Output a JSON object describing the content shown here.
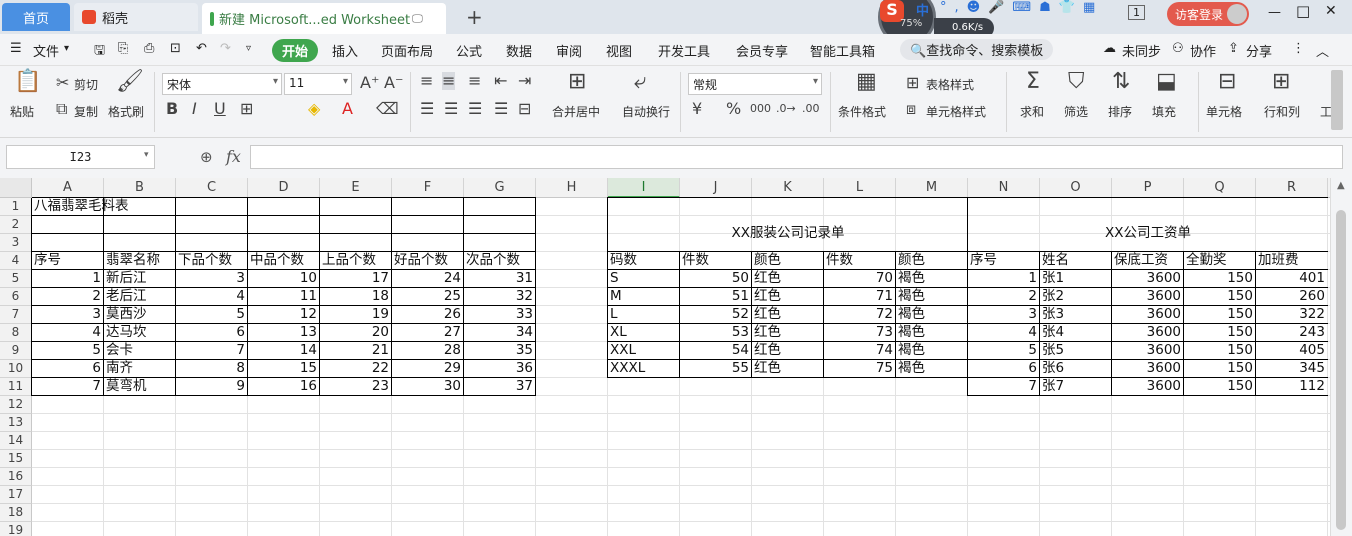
{
  "tabs": {
    "home": "首页",
    "daoke": "稻壳",
    "doc": "新建 Microsoft...ed Worksheet",
    "add": "+"
  },
  "window": {
    "guest": "访客登录",
    "minimize": "—",
    "restore": "□",
    "close": "✕",
    "page_icon": "1"
  },
  "widget": {
    "percent": "75%",
    "speed": "0.6K/s",
    "ime": "中"
  },
  "menu": {
    "file": "文件",
    "start": "开始",
    "insert": "插入",
    "layout": "页面布局",
    "formula": "公式",
    "data": "数据",
    "review": "审阅",
    "view": "视图",
    "dev": "开发工具",
    "member": "会员专享",
    "smart": "智能工具箱",
    "search": "查找命令、搜索模板",
    "unsync": "未同步",
    "collab": "协作",
    "share": "分享"
  },
  "ribbon": {
    "paste": "粘贴",
    "cut": "剪切",
    "copy": "复制",
    "format_painter": "格式刷",
    "font": "宋体",
    "size": "11",
    "merge": "合并居中",
    "wrap": "自动换行",
    "numfmt": "常规",
    "table_style": "表格样式",
    "cond_fmt": "条件格式",
    "cell_style": "单元格样式",
    "sum": "求和",
    "filter": "筛选",
    "sort": "排序",
    "fill": "填充",
    "cells": "单元格",
    "rowcol": "行和列",
    "work": "工"
  },
  "formula": {
    "namebox": "I23",
    "fx": "fx",
    "value": ""
  },
  "columns": [
    "A",
    "B",
    "C",
    "D",
    "E",
    "F",
    "G",
    "H",
    "I",
    "J",
    "K",
    "L",
    "M",
    "N",
    "O",
    "P",
    "Q",
    "R"
  ],
  "rows": [
    "1",
    "2",
    "3",
    "4",
    "5",
    "6",
    "7",
    "8",
    "9",
    "10",
    "11",
    "12",
    "13",
    "14",
    "15",
    "16",
    "17",
    "18",
    "19"
  ],
  "table1": {
    "title": "八福翡翠毛料表",
    "headers": [
      "序号",
      "翡翠名称",
      "下品个数",
      "中品个数",
      "上品个数",
      "好品个数",
      "次品个数"
    ],
    "rows": [
      [
        "1",
        "新后江",
        "3",
        "10",
        "17",
        "24",
        "31"
      ],
      [
        "2",
        "老后江",
        "4",
        "11",
        "18",
        "25",
        "32"
      ],
      [
        "3",
        "莫西沙",
        "5",
        "12",
        "19",
        "26",
        "33"
      ],
      [
        "4",
        "达马坎",
        "6",
        "13",
        "20",
        "27",
        "34"
      ],
      [
        "5",
        "会卡",
        "7",
        "14",
        "21",
        "28",
        "35"
      ],
      [
        "6",
        "南齐",
        "8",
        "15",
        "22",
        "29",
        "36"
      ],
      [
        "7",
        "莫弯机",
        "9",
        "16",
        "23",
        "30",
        "37"
      ]
    ]
  },
  "table2": {
    "title": "XX服装公司记录单",
    "headers": [
      "码数",
      "件数",
      "颜色",
      "件数",
      "颜色"
    ],
    "rows": [
      [
        "S",
        "50",
        "红色",
        "70",
        "褐色"
      ],
      [
        "M",
        "51",
        "红色",
        "71",
        "褐色"
      ],
      [
        "L",
        "52",
        "红色",
        "72",
        "褐色"
      ],
      [
        "XL",
        "53",
        "红色",
        "73",
        "褐色"
      ],
      [
        "XXL",
        "54",
        "红色",
        "74",
        "褐色"
      ],
      [
        "XXXL",
        "55",
        "红色",
        "75",
        "褐色"
      ]
    ]
  },
  "table3": {
    "title": "XX公司工资单",
    "headers": [
      "序号",
      "姓名",
      "保底工资",
      "全勤奖",
      "加班费"
    ],
    "rows": [
      [
        "1",
        "张1",
        "3600",
        "150",
        "401"
      ],
      [
        "2",
        "张2",
        "3600",
        "150",
        "260"
      ],
      [
        "3",
        "张3",
        "3600",
        "150",
        "322"
      ],
      [
        "4",
        "张4",
        "3600",
        "150",
        "243"
      ],
      [
        "5",
        "张5",
        "3600",
        "150",
        "405"
      ],
      [
        "6",
        "张6",
        "3600",
        "150",
        "345"
      ],
      [
        "7",
        "张7",
        "3600",
        "150",
        "112"
      ]
    ]
  },
  "colors": {
    "accent": "#3fa64e",
    "tab_blue": "#4a90e2",
    "selected_col": "#dce9dc"
  }
}
